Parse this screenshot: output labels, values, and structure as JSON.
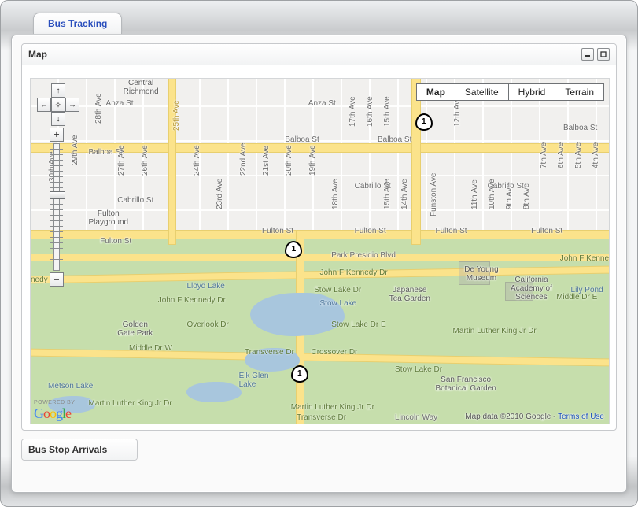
{
  "tab": {
    "label": "Bus Tracking"
  },
  "map_panel": {
    "title": "Map",
    "maptype": {
      "map": "Map",
      "satellite": "Satellite",
      "hybrid": "Hybrid",
      "terrain": "Terrain",
      "active": "Map"
    },
    "hwy": "1",
    "streets": {
      "anza": "Anza St",
      "balboa": "Balboa St",
      "cabrillo": "Cabrillo St",
      "fulton": "Fulton St",
      "presidio": "Park Presidio Blvd",
      "jfk": "John F Kennedy Dr",
      "jfk_short": "John F Kenne",
      "mlk": "Martin Luther King Jr Dr",
      "crossover": "Crossover Dr",
      "transverse": "Transverse Dr",
      "overlook": "Overlook Dr",
      "stowE": "Stow Lake Dr E",
      "stow": "Stow Lake Dr",
      "middle_w": "Middle Dr W",
      "middle_e": "Middle Dr E",
      "lincoln": "Lincoln Way",
      "nedy": "nedy Dr"
    },
    "avenues": {
      "a30": "30th Ave",
      "a29": "29th Ave",
      "a28": "28th Ave",
      "a27": "27th Ave",
      "a26": "26th Ave",
      "a25": "25th Ave",
      "a24": "24th Ave",
      "a23": "23rd Ave",
      "a22": "22nd Ave",
      "a21": "21st Ave",
      "a20": "20th Ave",
      "a19": "19th Ave",
      "a18": "18th Ave",
      "a17": "17th Ave",
      "a16": "16th Ave",
      "a15": "15th Ave",
      "a14": "14th Ave",
      "a12": "12th Ave",
      "a11": "11th Ave",
      "a10": "10th Ave",
      "a9": "9th Ave",
      "a8": "8th Ave",
      "a7": "7th Ave",
      "a6": "6th Ave",
      "a5": "5th Ave",
      "a4": "4th Ave",
      "funston": "Funston Ave",
      "pk": "Park Presidio Blvd"
    },
    "poi": {
      "central_richmond": "Central\nRichmond",
      "richmond": "Richmond",
      "fulton_pg": "Fulton\nPlayground",
      "lloyd": "Lloyd Lake",
      "ggp": "Golden\nGate Park",
      "elk": "Elk Glen\nLake",
      "metson": "Metson Lake",
      "japanese": "Japanese\nTea Garden",
      "deyoung": "De Young\nMuseum",
      "cas": "California\nAcademy of\nSciences",
      "botanical": "San Francisco\nBotanical Garden",
      "stow": "Stow Lake",
      "lily": "Lily Pond"
    },
    "logo_powered": "POWERED BY",
    "attribution": {
      "text": "Map data ©2010 Google -",
      "link": "Terms of Use"
    }
  },
  "arrivals_panel": {
    "title": "Bus Stop Arrivals"
  }
}
